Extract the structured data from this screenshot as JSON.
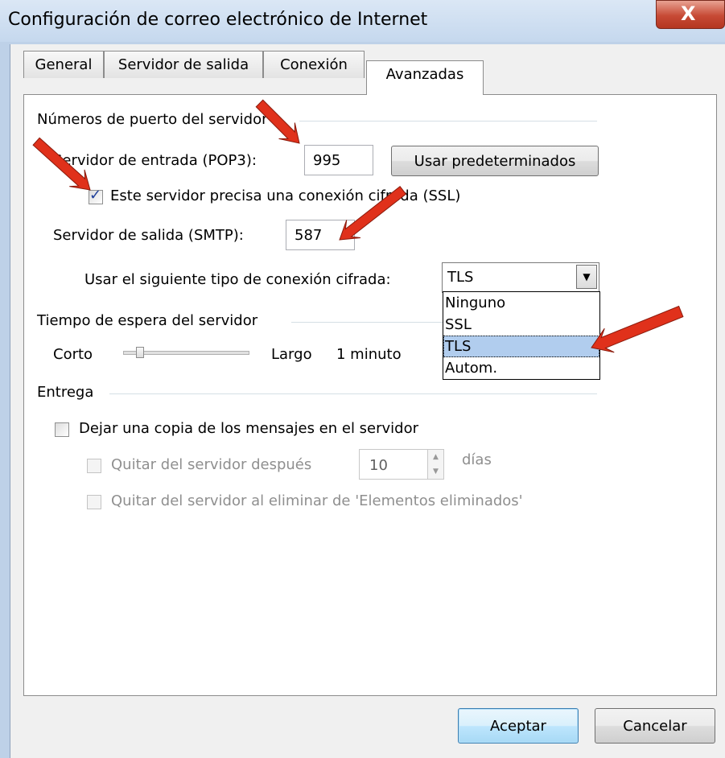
{
  "window": {
    "title": "Configuración de correo electrónico de Internet",
    "close_glyph": "X"
  },
  "tabs": [
    "General",
    "Servidor de salida",
    "Conexión",
    "Avanzadas"
  ],
  "ports": {
    "section_title": "Números de puerto del servidor",
    "incoming_label": "Servidor de entrada (POP3):",
    "incoming_value": "995",
    "defaults_button": "Usar predeterminados",
    "ssl_checkbox_label": "Este servidor precisa una conexión cifrada (SSL)",
    "ssl_checked": true,
    "outgoing_label": "Servidor de salida (SMTP):",
    "outgoing_value": "587",
    "encryption_label": "Usar el siguiente tipo de conexión cifrada:",
    "encryption_selected": "TLS",
    "encryption_options": [
      "Ninguno",
      "SSL",
      "TLS",
      "Autom."
    ]
  },
  "timeout": {
    "section_title": "Tiempo de espera del servidor",
    "short_label": "Corto",
    "long_label": "Largo",
    "value_text": "1 minuto",
    "slider_fraction": 0.1
  },
  "delivery": {
    "section_title": "Entrega",
    "leave_copy_label": "Dejar una copia de los mensajes en el servidor",
    "leave_copy_checked": false,
    "remove_after_label": "Quitar del servidor después",
    "remove_after_days": "10",
    "days_label": "días",
    "remove_deleted_label": "Quitar del servidor al eliminar de 'Elementos eliminados'"
  },
  "buttons": {
    "ok": "Aceptar",
    "cancel": "Cancelar"
  },
  "colors": {
    "annotation_arrow": "#e0311b",
    "selection": "#b1cdee"
  }
}
